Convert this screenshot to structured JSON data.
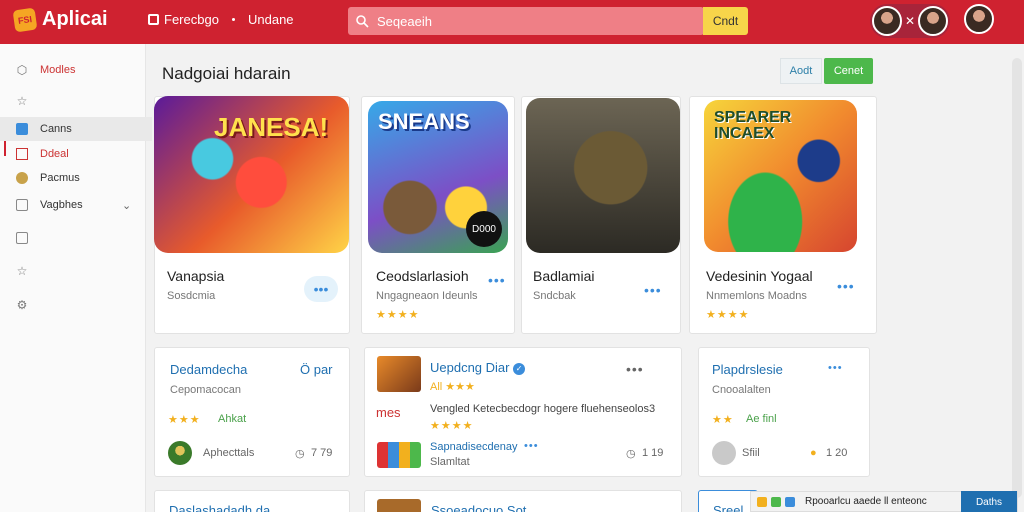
{
  "header": {
    "app_name": "Aplicai",
    "link1": "Ferecbgo",
    "link2": "Undane",
    "search_placeholder": "Seqeaeih",
    "search_button": "Cndt"
  },
  "sidebar": {
    "items": [
      {
        "label": "Modles"
      },
      {
        "label": ""
      },
      {
        "label": "Canns"
      },
      {
        "label": "Ddeal"
      },
      {
        "label": "Pacmus"
      },
      {
        "label": "Vagbhes"
      }
    ]
  },
  "main": {
    "section_title": "Nadgoiai hdarain",
    "about_button": "Aodt",
    "cancel_button": "Cenet",
    "featured": [
      {
        "name": "Vanapsia",
        "sub": "Sosdcmia",
        "stars": "",
        "art_title": "JANESA!",
        "art_badge": ""
      },
      {
        "name": "Ceodslarlasioh",
        "sub": "Nngagneaon Ideunls",
        "stars": "★★★★",
        "art_title": "SNEANS",
        "art_badge": "D000"
      },
      {
        "name": "Badlamiai",
        "sub": "Sndcbak",
        "stars": "",
        "art_title": "",
        "art_badge": ""
      },
      {
        "name": "Vedesinin Yogaal",
        "sub": "Nnmemlons Moadns",
        "stars": "★★★★",
        "art_title": "SPEARER INCAEX",
        "art_badge": ""
      }
    ],
    "cards": [
      {
        "name": "Dedamdecha",
        "tag": "Ö par",
        "sub": "Cepomacocan",
        "stars": "★★★",
        "stars_label": "Ahkat",
        "meta_left": "Aphecttals",
        "meta_right": "7 79"
      },
      {
        "name": "Uepdcng Diar",
        "sub": "All ★★★",
        "line": "Vengled Ketecbecdogr hogere fluehenseolos3",
        "stars": "★★★★",
        "line_prefix": "mes",
        "name2": "Sapnadisecdenay",
        "sub2": "Slamltat",
        "meta_right": "1 19"
      },
      {
        "name": "Plapdrslesie",
        "sub": "Cnooalalten",
        "stars": "★★",
        "stars_label": "Ae finl",
        "meta_left": "Sfiil",
        "meta_right": "1 20"
      }
    ],
    "row3": [
      {
        "name": "Daslashadadh da"
      },
      {
        "name": "Ssoeadocuo Sot"
      },
      {
        "name": "Sreel"
      }
    ]
  },
  "toast": {
    "text": "Rpooarlcu aaede ll enteonc",
    "button": "Daths"
  }
}
